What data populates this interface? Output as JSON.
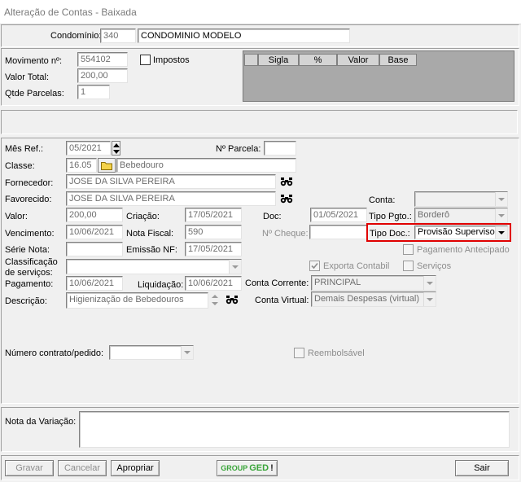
{
  "window": {
    "title": "Alteração de Contas - Baixada"
  },
  "condominio": {
    "label": "Condomínio:",
    "code": "340",
    "name": "CONDOMINIO MODELO"
  },
  "movimento": {
    "numero_label": "Movimento nº:",
    "numero": "554102",
    "valor_total_label": "Valor Total:",
    "valor_total": "200,00",
    "parcelas_label": "Qtde Parcelas:",
    "parcelas": "1",
    "impostos_label": "Impostos"
  },
  "grid": {
    "columns": [
      "Sigla",
      "%",
      "Valor",
      "Base"
    ]
  },
  "form": {
    "mes_ref_label": "Mês Ref.:",
    "mes_ref": "05/2021",
    "n_parcela_label": "Nº Parcela:",
    "n_parcela": "",
    "classe_label": "Classe:",
    "classe_code": "16.05",
    "classe_name": "Bebedouro",
    "fornecedor_label": "Fornecedor:",
    "fornecedor": "JOSE DA SILVA PEREIRA",
    "favorecido_label": "Favorecido:",
    "favorecido": "JOSE DA SILVA PEREIRA",
    "conta_label": "Conta:",
    "conta": "",
    "valor_label": "Valor:",
    "valor": "200,00",
    "criacao_label": "Criação:",
    "criacao": "17/05/2021",
    "doc_label": "Doc:",
    "doc": "01/05/2021",
    "tipo_pgto_label": "Tipo Pgto.:",
    "tipo_pgto": "Borderô",
    "vencimento_label": "Vencimento:",
    "vencimento": "10/06/2021",
    "nota_fiscal_label": "Nota Fiscal:",
    "nota_fiscal": "590",
    "n_cheque_label": "Nº Cheque:",
    "n_cheque": "",
    "tipo_doc_label": "Tipo Doc.:",
    "tipo_doc": "Provisão Supervisor",
    "serie_label": "Série Nota:",
    "serie": "",
    "emissao_label": "Emissão NF:",
    "emissao": "17/05/2021",
    "pag_antecipado_label": "Pagamento Antecipado",
    "classificacao_label_1": "Classificação",
    "classificacao_label_2": "de serviços:",
    "classificacao": "",
    "exporta_label": "Exporta Contabil",
    "servicos_label": "Serviços",
    "pagamento_label": "Pagamento:",
    "pagamento": "10/06/2021",
    "liquidacao_label": "Liquidação:",
    "liquidacao": "10/06/2021",
    "conta_corrente_label": "Conta Corrente:",
    "conta_corrente": "PRINCIPAL",
    "descricao_label": "Descrição:",
    "descricao": "Higienização de Bebedouros",
    "conta_virtual_label": "Conta Virtual:",
    "conta_virtual": "Demais Despesas (virtual)",
    "contrato_label": "Número contrato/pedido:",
    "contrato": "",
    "reembolsavel_label": "Reembolsável"
  },
  "nota_variacao": {
    "label": "Nota da Variação:",
    "value": ""
  },
  "buttons": {
    "gravar": "Gravar",
    "cancelar": "Cancelar",
    "apropriar": "Apropriar",
    "ged_group": "GROUP",
    "ged": "GED",
    "ged_bang": "!",
    "sair": "Sair"
  },
  "colors": {
    "highlight": "#e00000",
    "ged_green": "#3aa53a"
  }
}
